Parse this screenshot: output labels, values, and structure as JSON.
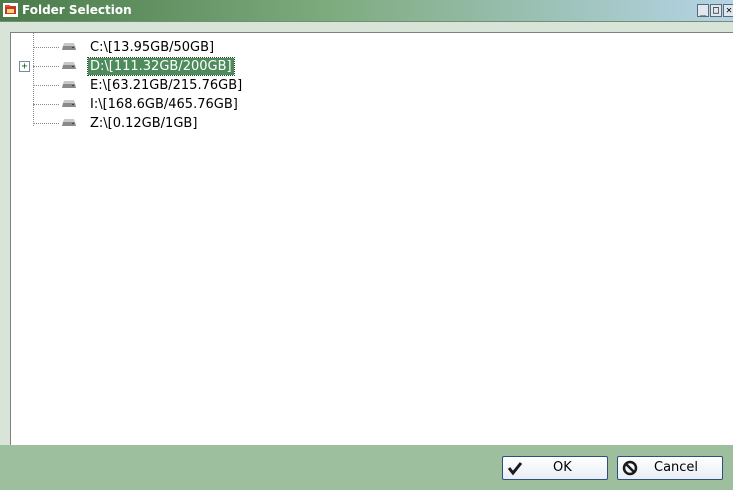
{
  "window": {
    "title": "Folder Selection",
    "controls": {
      "minimize": "_",
      "maximize": "□",
      "close": "✕"
    }
  },
  "tree": {
    "items": [
      {
        "label": "C:\\[13.95GB/50GB]",
        "expandable": false,
        "selected": false
      },
      {
        "label": "D:\\[111.32GB/200GB]",
        "expandable": true,
        "selected": true
      },
      {
        "label": "E:\\[63.21GB/215.76GB]",
        "expandable": false,
        "selected": false
      },
      {
        "label": "I:\\[168.6GB/465.76GB]",
        "expandable": false,
        "selected": false
      },
      {
        "label": "Z:\\[0.12GB/1GB]",
        "expandable": false,
        "selected": false
      }
    ],
    "expander_symbol": "+"
  },
  "buttons": {
    "ok_label": "OK",
    "cancel_label": "Cancel"
  },
  "colors": {
    "title_gradient_start": "#4a7a4a",
    "selection": "#4e8b5c",
    "bottom_bar": "#9dbf9d"
  },
  "icons": {
    "app": "folder-tree-icon",
    "drive": "hard-drive-icon",
    "ok": "checkmark-icon",
    "cancel": "prohibited-icon"
  }
}
